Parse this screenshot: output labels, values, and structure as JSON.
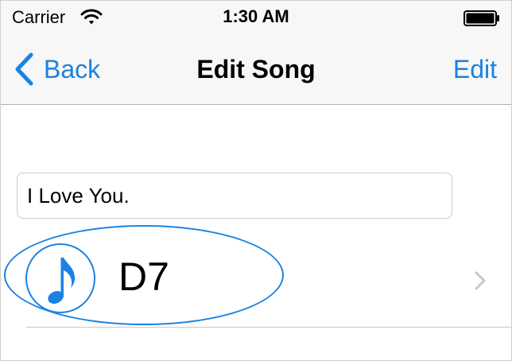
{
  "status_bar": {
    "carrier": "Carrier",
    "time": "1:30 AM"
  },
  "nav": {
    "back_label": "Back",
    "title": "Edit Song",
    "edit_label": "Edit"
  },
  "song": {
    "title_value": "I Love You.",
    "chord": "D7"
  },
  "colors": {
    "accent": "#1a82e2",
    "bar_background": "#f7f7f7",
    "separator": "#c8c7cc"
  },
  "icons": {
    "wifi": "wifi-icon",
    "battery": "battery-icon",
    "back": "chevron-left-icon",
    "note": "music-note-icon",
    "disclosure": "chevron-right-icon"
  }
}
